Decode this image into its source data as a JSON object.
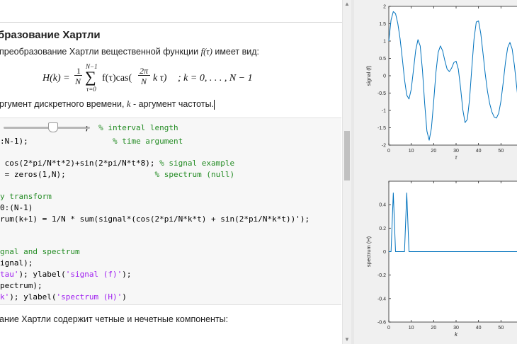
{
  "doc": {
    "heading": "бразование Хартли",
    "intro_text": "преобразование Хартли вещественной функции",
    "intro_func": "f(τ)",
    "intro_tail": "имеет вид:",
    "formula": {
      "lhs": "H(k) =",
      "frac_num": "1",
      "frac_den": "N",
      "sum_top": "N−1",
      "sum_sym": "∑",
      "sum_bottom": "τ=0",
      "body_start": "f(τ)cas(",
      "inner_num": "2π",
      "inner_den": "N",
      "body_end": "k τ)",
      "tail": "; k = 0, . . . , N − 1"
    },
    "arg_text_a": "ргумент дискретного времени,",
    "arg_k": "k",
    "arg_text_b": "- аргумент частоты.",
    "code_lines": {
      "l1_code": "                  ;  ",
      "l1_comment": "% interval length",
      "l2_code": ":N-1);                  ",
      "l2_comment": "% time argument",
      "l3_code": " cos(2*pi/N*t*2)+sin(2*pi/N*t*8); ",
      "l3_comment": "% signal example",
      "l4_code": " = zeros(1,N);                   ",
      "l4_comment": "% spectrum (null)",
      "l5_comment": "y transform",
      "l6_code": "0:(N-1)",
      "l7_code": "rum(k+1) = 1/N * sum(signal*(cos(2*pi/N*k*t) + sin(2*pi/N*k*t))');",
      "l8_comment": "gnal and spectrum",
      "l9_code": "ignal);",
      "l10_str1": "tau'",
      "l10_mid": "); ylabel(",
      "l10_str2": "'signal (f)'",
      "l10_end": ");",
      "l11_code": "pectrum);",
      "l12_str1": "k'",
      "l12_mid": "); ylabel(",
      "l12_str2": "'spectrum (H)'",
      "l12_end": ")"
    },
    "bottom_text": "ание Хартли содержит четные и нечетные компоненты:"
  },
  "chart_data": [
    {
      "type": "line",
      "title": "",
      "xlabel": "τ",
      "ylabel": "signal (f)",
      "xlim": [
        0,
        60
      ],
      "ylim": [
        -2,
        2
      ],
      "xticks": [
        "0",
        "10",
        "20",
        "30",
        "40",
        "50"
      ],
      "yticks": [
        "-2",
        "-1.5",
        "-1",
        "-0.5",
        "0",
        "0.5",
        "1",
        "1.5",
        "2"
      ],
      "grid": false,
      "series": [
        {
          "color": "#0072bd",
          "x": [
            0,
            1,
            2,
            3,
            4,
            5,
            6,
            7,
            8,
            9,
            10,
            11,
            12,
            13,
            14,
            15,
            16,
            17,
            18,
            19,
            20,
            21,
            22,
            23,
            24,
            25,
            26,
            27,
            28,
            29,
            30,
            31,
            32,
            33,
            34,
            35,
            36,
            37,
            38,
            39,
            40,
            41,
            42,
            43,
            44,
            45,
            46,
            47,
            48,
            49,
            50,
            51,
            52,
            53,
            54,
            55,
            56,
            57,
            58,
            59,
            60
          ],
          "y": [
            1.0,
            1.61,
            1.85,
            1.79,
            1.51,
            1.08,
            0.51,
            -0.11,
            -0.56,
            -0.67,
            -0.39,
            0.17,
            0.74,
            1.04,
            0.86,
            0.16,
            -0.81,
            -1.6,
            -1.86,
            -1.51,
            -0.75,
            0.09,
            0.67,
            0.86,
            0.72,
            0.43,
            0.19,
            0.12,
            0.22,
            0.38,
            0.42,
            0.19,
            -0.35,
            -0.98,
            -1.35,
            -1.26,
            -0.68,
            0.22,
            1.06,
            1.55,
            1.58,
            1.22,
            0.65,
            0.05,
            -0.45,
            -0.81,
            -1.05,
            -1.19,
            -1.22,
            -1.08,
            -0.73,
            -0.2,
            0.38,
            0.81,
            0.96,
            0.77,
            0.3,
            -0.31,
            -0.91,
            -1.35,
            -1.5
          ]
        }
      ]
    },
    {
      "type": "line",
      "title": "",
      "xlabel": "k",
      "ylabel": "spectrum (H)",
      "xlim": [
        0,
        60
      ],
      "ylim": [
        -0.6,
        0.6
      ],
      "xticks": [
        "0",
        "10",
        "20",
        "30",
        "40",
        "50"
      ],
      "yticks": [
        "-0.6",
        "-0.4",
        "-0.2",
        "0",
        "0.2",
        "0.4"
      ],
      "grid": false,
      "series": [
        {
          "color": "#0072bd",
          "x": [
            0,
            1,
            2,
            3,
            4,
            5,
            6,
            7,
            8,
            9,
            10,
            20,
            30,
            40,
            50,
            60
          ],
          "y": [
            0,
            0,
            0.5,
            0,
            0,
            0,
            0,
            0,
            0.5,
            0,
            0,
            0,
            0,
            0,
            0,
            0
          ]
        }
      ]
    }
  ]
}
